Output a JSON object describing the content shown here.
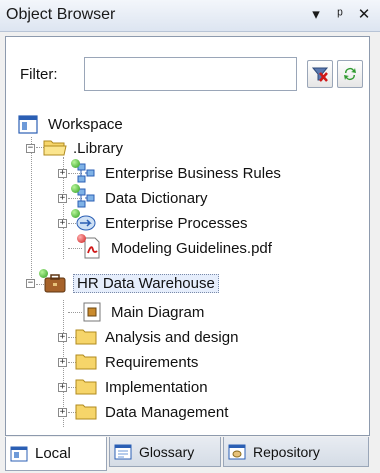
{
  "window": {
    "title": "Object Browser"
  },
  "titlebar_icons": [
    "dropdown-arrow-icon",
    "pin-icon",
    "close-icon"
  ],
  "filter": {
    "label": "Filter:",
    "value": "",
    "placeholder": ""
  },
  "tree": {
    "root": {
      "label": "Workspace"
    },
    "library": {
      "label": ".Library",
      "children": [
        {
          "label": "Enterprise Business Rules"
        },
        {
          "label": "Data Dictionary"
        },
        {
          "label": "Enterprise Processes"
        },
        {
          "label": "Modeling Guidelines.pdf"
        }
      ]
    },
    "project": {
      "label": "HR Data Warehouse",
      "children": [
        {
          "label": "Main Diagram"
        },
        {
          "label": "Analysis and design"
        },
        {
          "label": "Requirements"
        },
        {
          "label": "Implementation"
        },
        {
          "label": "Data Management"
        }
      ]
    }
  },
  "tabs": [
    {
      "label": "Local"
    },
    {
      "label": "Glossary"
    },
    {
      "label": "Repository"
    }
  ],
  "colors": {
    "folder": "#f6d56a",
    "selection": "#3399ff",
    "panel_border": "#8d9aad"
  }
}
